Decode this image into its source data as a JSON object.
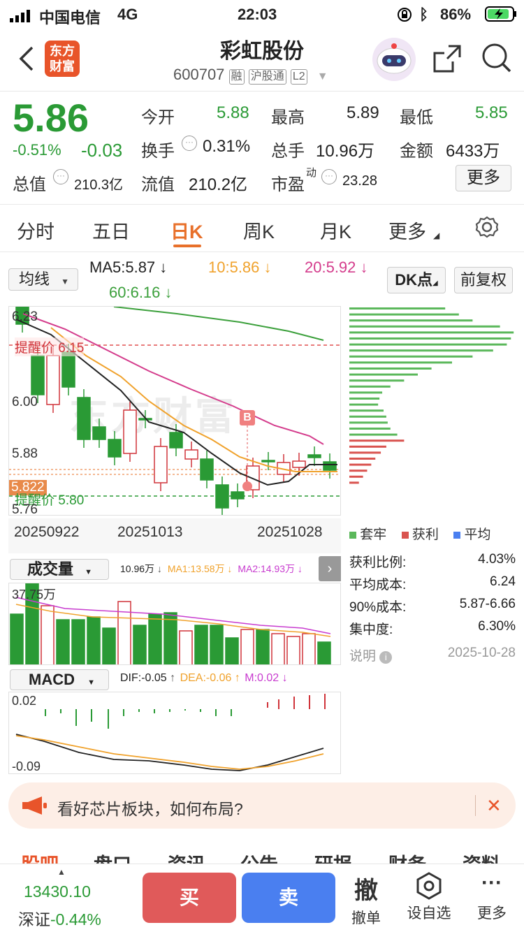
{
  "status": {
    "carrier": "中国电信",
    "network": "4G",
    "time": "22:03",
    "battery": "86%"
  },
  "header": {
    "brand_logo_text": "东方财富",
    "title": "彩虹股份",
    "code": "600707",
    "tags": [
      "融",
      "沪股通",
      "L2"
    ]
  },
  "quote": {
    "price": "5.86",
    "change_pct": "-0.51%",
    "change": "-0.03",
    "open_label": "今开",
    "open": "5.88",
    "high_label": "最高",
    "high": "5.89",
    "low_label": "最低",
    "low": "5.85",
    "turnover_label": "换手",
    "turnover": "0.31%",
    "volume_label": "总手",
    "volume": "10.96万",
    "amount_label": "金额",
    "amount": "6433万",
    "mcap_label": "总值",
    "mcap": "210.3亿",
    "float_label": "流值",
    "float_cap": "210.2亿",
    "pe_label": "市盈",
    "pe_sup": "动",
    "pe": "23.28",
    "more_label": "更多"
  },
  "tabs": {
    "items": [
      "分时",
      "五日",
      "日K",
      "周K",
      "月K",
      "更多"
    ],
    "active": "日K"
  },
  "ma": {
    "selector": "均线",
    "ma5": "MA5:5.87",
    "ma10": "10:5.86",
    "ma20": "20:5.92",
    "ma60": "60:6.16",
    "dk": "DK点",
    "adjust": "前复权"
  },
  "kchart": {
    "price_labels": [
      "6.23",
      "6.00",
      "5.88",
      "5.822",
      "5.76"
    ],
    "alert_high": "提醒价 6.15",
    "alert_low": "提醒价 5.80",
    "dates": [
      "20250922",
      "20251013",
      "20251028"
    ],
    "b_marker": "B",
    "watermark": "东方财富"
  },
  "chip": {
    "legend": [
      "套牢",
      "获利",
      "平均"
    ],
    "rows": [
      {
        "label": "获利比例:",
        "value": "4.03%"
      },
      {
        "label": "平均成本:",
        "value": "6.24"
      },
      {
        "label": "90%成本:",
        "value": "5.87-6.66"
      },
      {
        "label": "集中度:",
        "value": "6.30%"
      }
    ],
    "note": "说明",
    "date": "2025-10-28"
  },
  "volume": {
    "selector": "成交量",
    "vol": "10.96万",
    "ma1": "MA1:13.58万",
    "ma2": "MA2:14.93万",
    "max": "37.75万"
  },
  "macd": {
    "selector": "MACD",
    "dif": "DIF:-0.05",
    "dea": "DEA:-0.06",
    "m": "M:0.02",
    "top": "0.02",
    "bottom": "-0.09"
  },
  "banner": {
    "text": "看好芯片板块，如何布局?"
  },
  "subtabs": [
    "股吧",
    "盘口",
    "资讯",
    "公告",
    "研报",
    "财务",
    "资料"
  ],
  "bottom": {
    "index_value": "13430.10",
    "index_name": "深证",
    "index_change": "-0.44%",
    "buy": "买",
    "sell": "卖",
    "cancel_icon": "撤",
    "cancel": "撤单",
    "watch": "设自选",
    "more": "更多"
  },
  "colors": {
    "green": "#2a9a35",
    "red": "#d0343a",
    "ma5": "#222222",
    "ma10": "#f0a22c",
    "ma20": "#d43c8c",
    "ma60": "#3ca03c",
    "accent": "#e8702a",
    "buy": "#e05a5a",
    "sell": "#4a7ff0"
  }
}
